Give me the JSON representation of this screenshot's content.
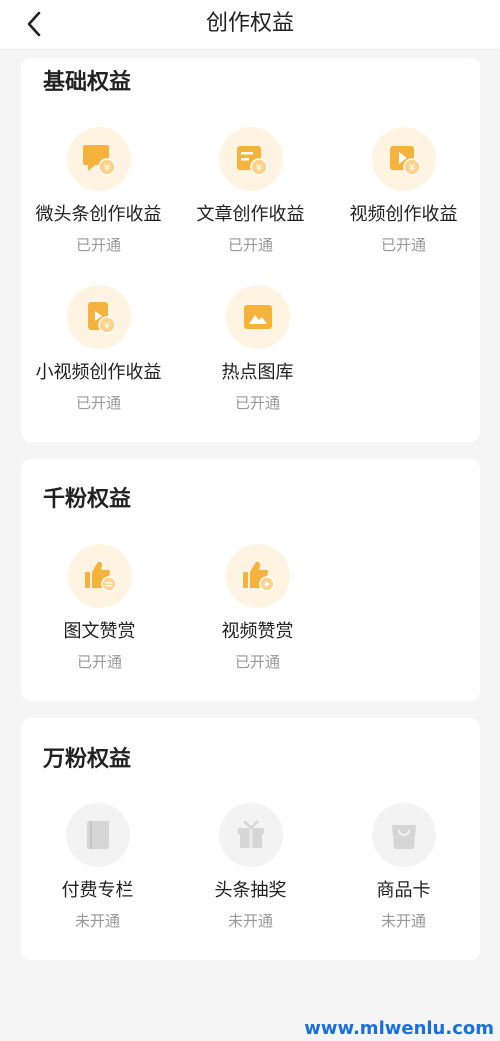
{
  "header": {
    "title": "创作权益",
    "back_icon": "chevron-left-icon"
  },
  "colors": {
    "accent": "#f5b23c",
    "accent_bg": "#fff4e2",
    "disabled": "#d6d6d6",
    "disabled_bg": "#f3f3f3"
  },
  "sections": [
    {
      "title": "基础权益",
      "items": [
        {
          "label": "微头条创作收益",
          "status": "已开通",
          "icon": "chat-bubble-yuan-icon"
        },
        {
          "label": "文章创作收益",
          "status": "已开通",
          "icon": "article-yuan-icon"
        },
        {
          "label": "视频创作收益",
          "status": "已开通",
          "icon": "video-yuan-icon"
        },
        {
          "label": "小视频创作收益",
          "status": "已开通",
          "icon": "short-video-yuan-icon"
        },
        {
          "label": "热点图库",
          "status": "已开通",
          "icon": "image-gallery-icon"
        }
      ]
    },
    {
      "title": "千粉权益",
      "items": [
        {
          "label": "图文赞赏",
          "status": "已开通",
          "icon": "thumbs-up-text-icon"
        },
        {
          "label": "视频赞赏",
          "status": "已开通",
          "icon": "thumbs-up-video-icon"
        }
      ]
    },
    {
      "title": "万粉权益",
      "items": [
        {
          "label": "付费专栏",
          "status": "未开通",
          "icon": "book-icon"
        },
        {
          "label": "头条抽奖",
          "status": "未开通",
          "icon": "gift-box-icon"
        },
        {
          "label": "商品卡",
          "status": "未开通",
          "icon": "shopping-bag-icon"
        }
      ]
    }
  ],
  "watermark": "www.mlwenlu.com"
}
